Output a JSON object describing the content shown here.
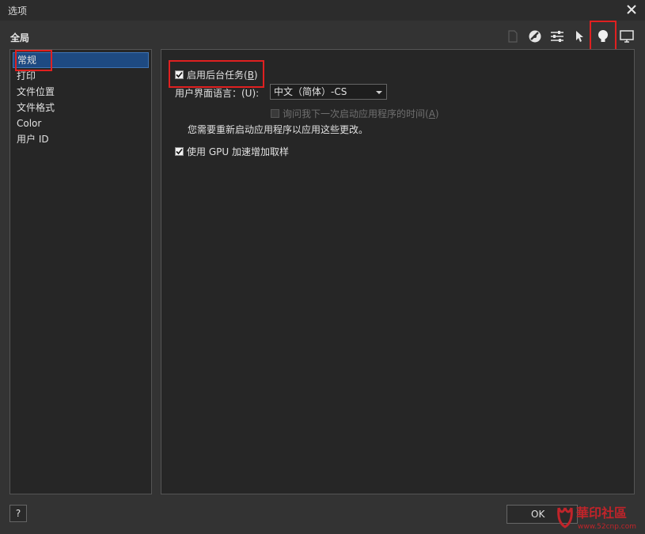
{
  "window": {
    "title": "选项"
  },
  "section": {
    "label": "全局"
  },
  "sidebar": {
    "items": [
      {
        "label": "常规"
      },
      {
        "label": "打印"
      },
      {
        "label": "文件位置"
      },
      {
        "label": "文件格式"
      },
      {
        "label": "Color"
      },
      {
        "label": "用户 ID"
      }
    ]
  },
  "panel": {
    "enable_background": {
      "label": "启用后台任务(",
      "mnemonic": "B",
      "suffix": ")",
      "checked": true
    },
    "ui_language": {
      "label": "用户界面语言：(U):",
      "value": "中文（简体）-CS"
    },
    "ask_next_launch": {
      "label": "询问我下一次启动应用程序的时间(",
      "mnemonic": "A",
      "suffix": ")",
      "checked": false
    },
    "restart_note": "您需要重新启动应用程序以应用这些更改。",
    "gpu_accel": {
      "label": "使用 GPU 加速增加取样",
      "checked": true
    }
  },
  "footer": {
    "help_label": "?",
    "ok_label": "OK"
  },
  "watermark": {
    "text": "華印社區",
    "url": "www.52cnp.com"
  },
  "colors": {
    "accent": "#1e4a82",
    "highlight": "#e02020",
    "background": "#333333"
  }
}
